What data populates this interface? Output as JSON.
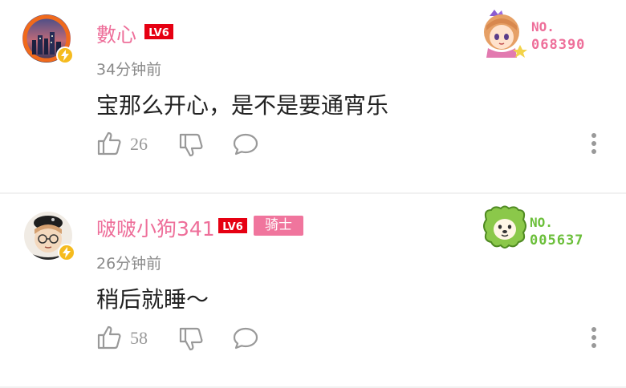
{
  "comments": [
    {
      "username": "數心",
      "level": "LV6",
      "time": "34分钟前",
      "text": "宝那么开心，是不是要通宵乐",
      "likes": "26",
      "fan_no_label": "NO.",
      "fan_number": "068390",
      "fan_color": "#ee6f9a"
    },
    {
      "username": "啵啵小狗341",
      "level": "LV6",
      "medal": "骑士",
      "time": "26分钟前",
      "text": "稍后就睡～",
      "likes": "58",
      "fan_no_label": "NO.",
      "fan_number": "005637",
      "fan_color": "#6bbf3a"
    }
  ],
  "colors": {
    "username": "#ee6f9a",
    "level_badge": "#e60012",
    "medal": "#f0759d",
    "verified_bolt": "#f5bb1f"
  },
  "icons": [
    "like-icon",
    "dislike-icon",
    "reply-icon",
    "more-icon",
    "bolt-icon"
  ]
}
